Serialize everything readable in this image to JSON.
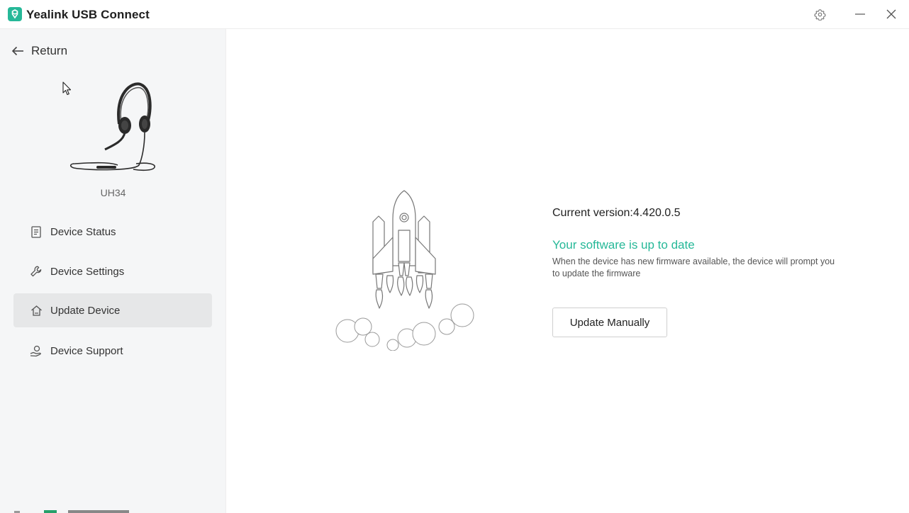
{
  "app": {
    "title": "Yealink USB Connect",
    "brand_color": "#26b898"
  },
  "titlebar": {
    "settings_icon": "gear-icon",
    "minimize_icon": "minimize-icon",
    "close_icon": "close-icon"
  },
  "sidebar": {
    "return_label": "Return",
    "device_name": "UH34",
    "items": [
      {
        "label": "Device Status",
        "icon": "document-icon",
        "active": false
      },
      {
        "label": "Device Settings",
        "icon": "wrench-icon",
        "active": false
      },
      {
        "label": "Update Device",
        "icon": "upload-house-icon",
        "active": true
      },
      {
        "label": "Device Support",
        "icon": "support-hand-icon",
        "active": false
      }
    ]
  },
  "main": {
    "current_version": "Current version:4.420.0.5",
    "status_title": "Your software is up to date",
    "status_desc": "When the device has new firmware available, the device will prompt you to update the firmware",
    "update_button": "Update Manually"
  }
}
